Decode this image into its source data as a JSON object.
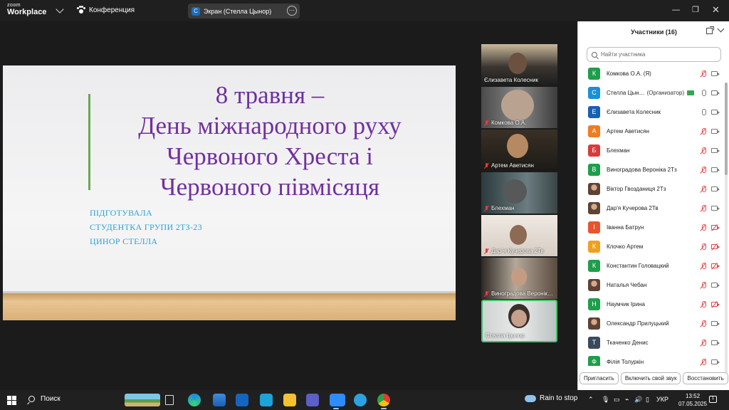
{
  "titlebar": {
    "logo_line1": "zoom",
    "logo_line2": "Workplace",
    "meeting_label": "Конференция",
    "share_avatar": "С",
    "share_label": "Экран (Стелла Цынор)",
    "more": "···"
  },
  "slide": {
    "title_lines": [
      "8 травня –",
      "День міжнародного руху",
      "Червоного Хреста і",
      "Червоного півмісяця"
    ],
    "sub_lines": [
      "ПІДГОТУВАЛА",
      "СТУДЕНТКА ГРУПИ 2ТЗ-23",
      "ЦИНОР СТЕЛЛА"
    ]
  },
  "video_tiles": [
    {
      "name": "Єлизавета Колесник",
      "muted": false
    },
    {
      "name": "Комкова О.А.",
      "muted": true
    },
    {
      "name": "Артем Аветисян",
      "muted": true
    },
    {
      "name": "Блехман",
      "muted": true
    },
    {
      "name": "Дар`я Кучерова 2Тв",
      "muted": true
    },
    {
      "name": "Виноградова Веронік…",
      "muted": true
    },
    {
      "name": "Стелла Цынор",
      "muted": false,
      "active": true
    }
  ],
  "panel": {
    "title": "Участники (16)",
    "search_placeholder": "Найти участника",
    "participants": [
      {
        "initial": "К",
        "color": "#1e9e4a",
        "name": "Комкова О.А. (Я)",
        "mic": "muted",
        "cam": "on"
      },
      {
        "initial": "С",
        "color": "#1c8fd6",
        "name": "Стелла Цын…",
        "role": "(Организатор)",
        "host": true,
        "mic": "on",
        "cam": "on"
      },
      {
        "initial": "Е",
        "color": "#1a5fb4",
        "name": "Єлизавета Колесник",
        "mic": "on",
        "cam": "on"
      },
      {
        "initial": "А",
        "color": "#f07c22",
        "name": "Артем Аветисян",
        "mic": "muted",
        "cam": "on"
      },
      {
        "initial": "Б",
        "color": "#d93b3b",
        "name": "Блехман",
        "mic": "muted",
        "cam": "on"
      },
      {
        "initial": "В",
        "color": "#1e9e4a",
        "name": "Виноградова Вероніка 2Тз",
        "mic": "muted",
        "cam": "on"
      },
      {
        "initial": "",
        "color": "photo",
        "name": "Віктор Гвозданиця 2Тз",
        "mic": "muted",
        "cam": "on"
      },
      {
        "initial": "",
        "color": "photo",
        "name": "Дар'я Кучерова 2Тв",
        "mic": "muted",
        "cam": "on"
      },
      {
        "initial": "І",
        "color": "#e8542e",
        "name": "Іванна Батрун",
        "mic": "muted",
        "cam": "off"
      },
      {
        "initial": "К",
        "color": "#f0a020",
        "name": "Клочко Артем",
        "mic": "muted",
        "cam": "off"
      },
      {
        "initial": "К",
        "color": "#1e9e4a",
        "name": "Константин Головацкий",
        "mic": "muted",
        "cam": "off"
      },
      {
        "initial": "",
        "color": "photo",
        "name": "Наталья Чебан",
        "mic": "muted",
        "cam": "on"
      },
      {
        "initial": "Н",
        "color": "#1e9e4a",
        "name": "Наумчик Ірина",
        "mic": "muted",
        "cam": "off"
      },
      {
        "initial": "",
        "color": "photo",
        "name": "Олександр Прилуцький",
        "mic": "muted",
        "cam": "on"
      },
      {
        "initial": "Т",
        "color": "#3a4a5c",
        "name": "Ткаченко Денис",
        "mic": "muted",
        "cam": "on"
      },
      {
        "initial": "Ф",
        "color": "#1e9e4a",
        "name": "Філія Толуркін",
        "mic": "muted",
        "cam": "on"
      }
    ],
    "footer_buttons": [
      "Пригласить",
      "Включить свой звук",
      "Восстановить"
    ]
  },
  "taskbar": {
    "search_label": "Поиск",
    "weather": "Rain to stop",
    "lang": "УКР",
    "time": "13:52",
    "date": "07.05.2025",
    "notif_count": "1"
  }
}
